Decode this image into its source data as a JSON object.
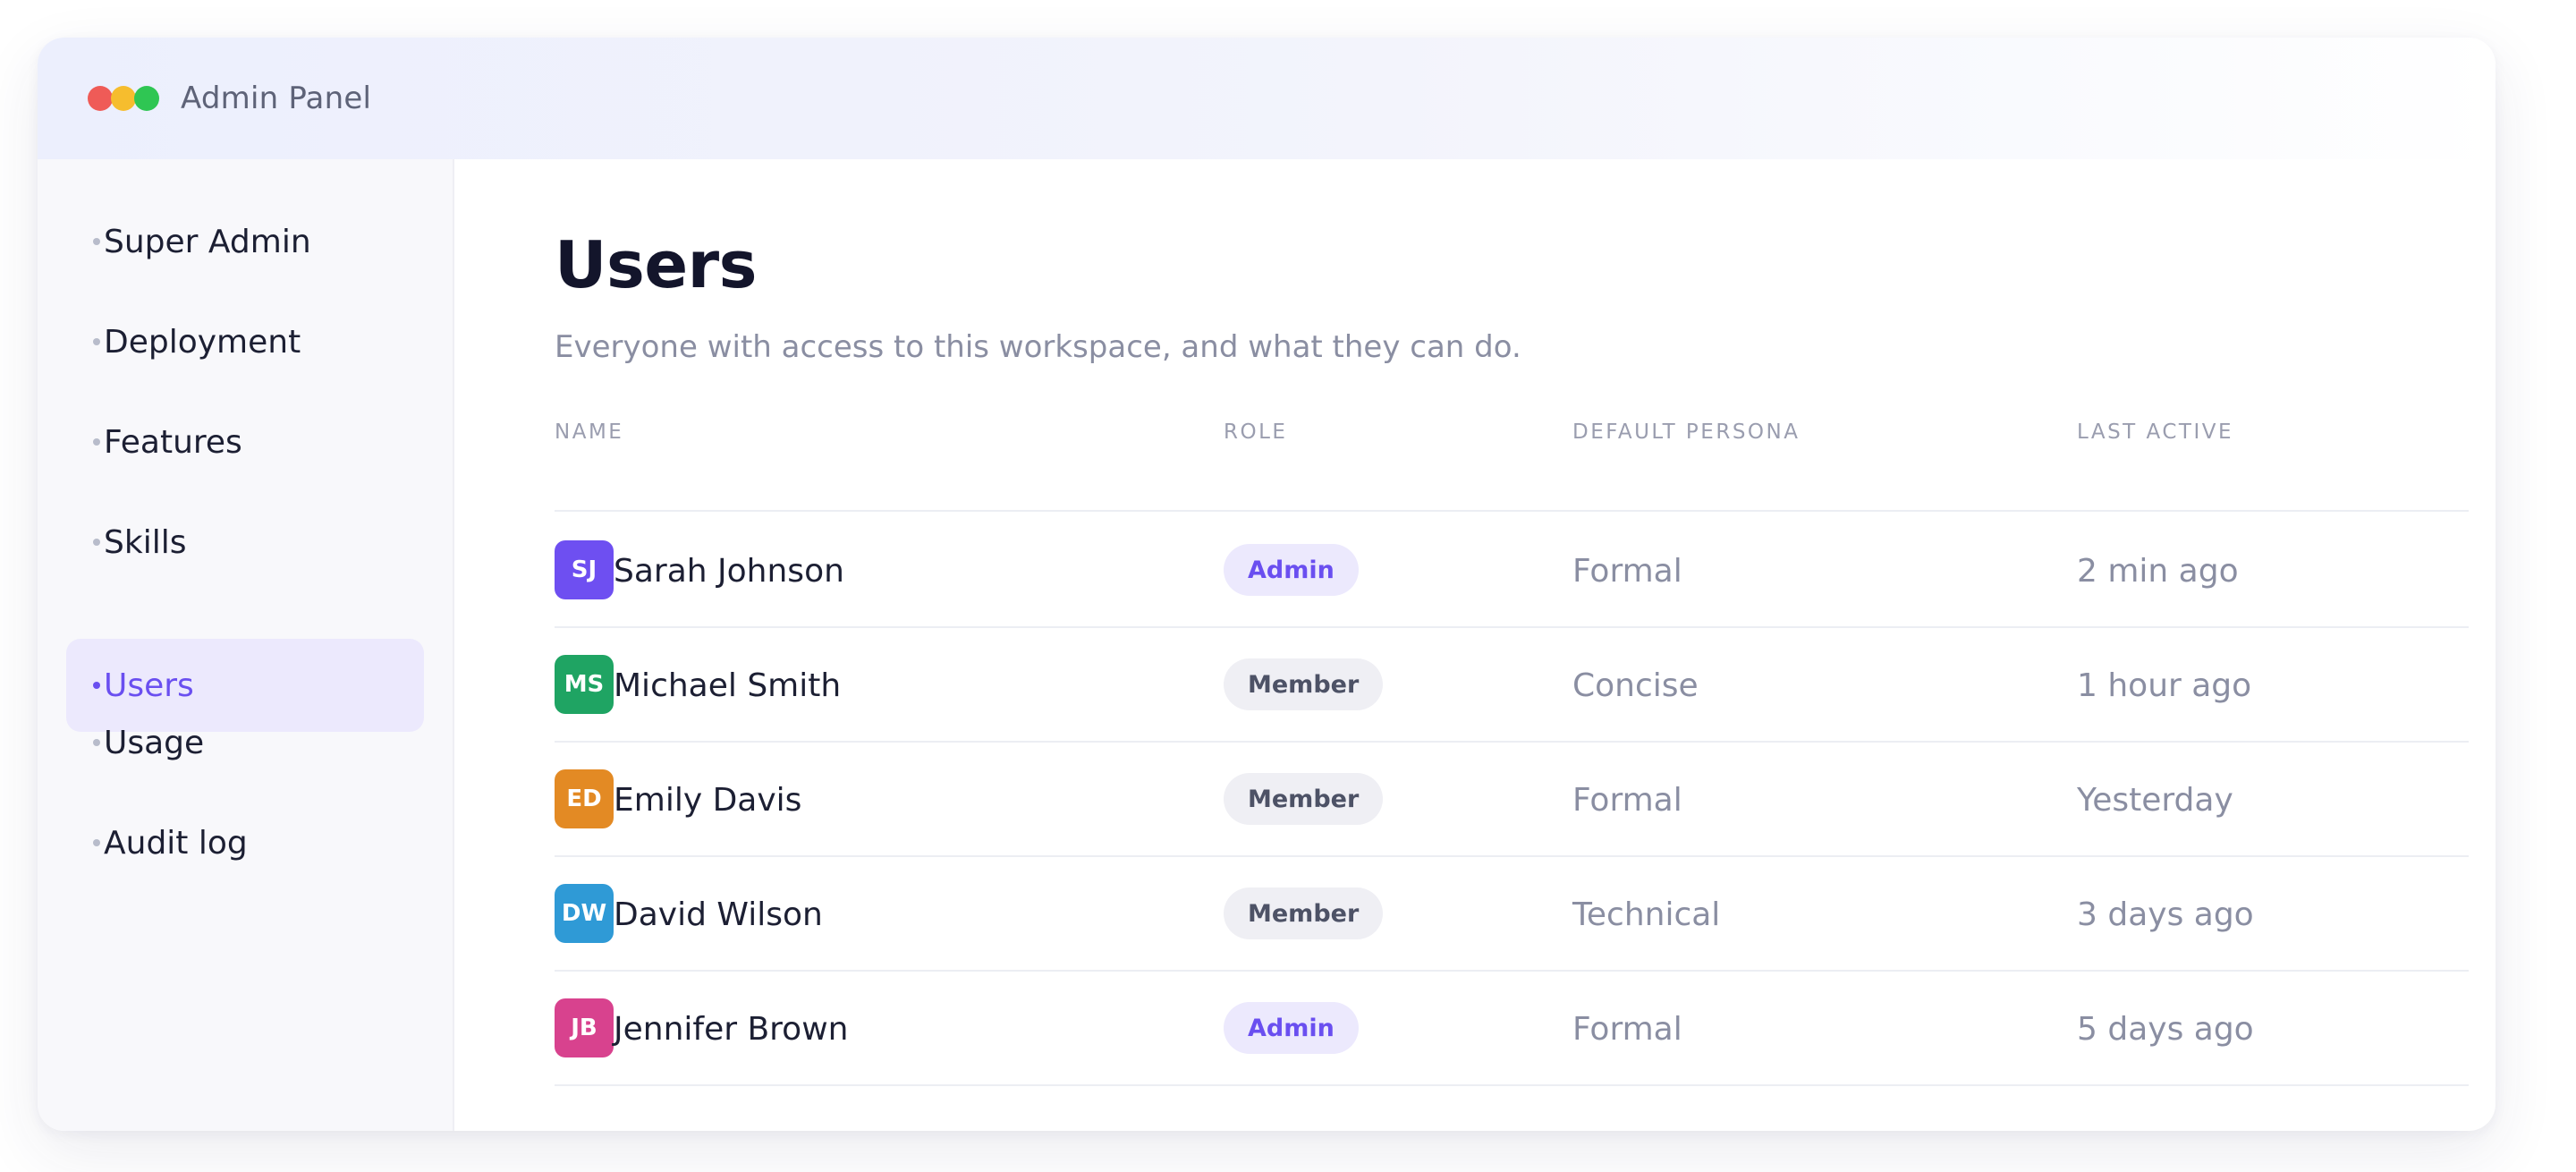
{
  "window": {
    "title": "Admin Panel"
  },
  "sidebar": {
    "items": [
      {
        "label": "Super Admin",
        "active": false
      },
      {
        "label": "Deployment",
        "active": false
      },
      {
        "label": "Features",
        "active": false
      },
      {
        "label": "Skills",
        "active": false
      },
      {
        "label": "Users",
        "active": true
      },
      {
        "label": "Usage",
        "active": false
      },
      {
        "label": "Audit log",
        "active": false
      }
    ]
  },
  "main": {
    "title": "Users",
    "subtitle": "Everyone with access to this workspace, and what they can do.",
    "table": {
      "headers": [
        "NAME",
        "ROLE",
        "DEFAULT PERSONA",
        "LAST ACTIVE"
      ],
      "rows": [
        {
          "initials": "SJ",
          "avatar_color": "#6e4ff1",
          "name": "Sarah Johnson",
          "role": "Admin",
          "persona": "Formal",
          "last_active": "2 min ago"
        },
        {
          "initials": "MS",
          "avatar_color": "#1fa463",
          "name": "Michael Smith",
          "role": "Member",
          "persona": "Concise",
          "last_active": "1 hour ago"
        },
        {
          "initials": "ED",
          "avatar_color": "#e38a24",
          "name": "Emily Davis",
          "role": "Member",
          "persona": "Formal",
          "last_active": "Yesterday"
        },
        {
          "initials": "DW",
          "avatar_color": "#2f9ad6",
          "name": "David Wilson",
          "role": "Member",
          "persona": "Technical",
          "last_active": "3 days ago"
        },
        {
          "initials": "JB",
          "avatar_color": "#d8428e",
          "name": "Jennifer Brown",
          "role": "Admin",
          "persona": "Formal",
          "last_active": "5 days ago"
        }
      ]
    }
  },
  "colors": {
    "accent": "#6a4ff0",
    "accent_bg": "#ece9fd",
    "traffic_red": "#ef5b57",
    "traffic_yellow": "#f6bd2e",
    "traffic_green": "#2fc653"
  }
}
